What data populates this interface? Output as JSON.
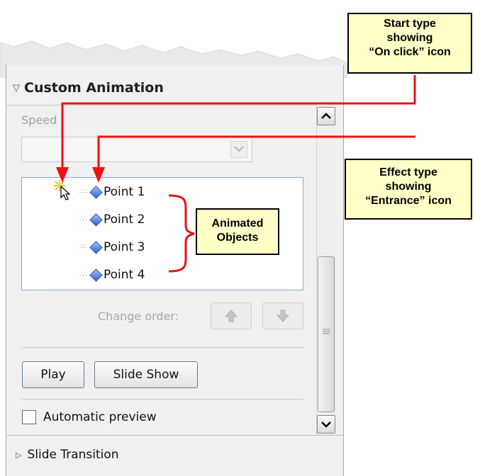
{
  "panel": {
    "header_title": "Custom Animation",
    "speed_label": "Speed",
    "speed_value": "",
    "list_items": [
      "Point 1",
      "Point 2",
      "Point 3",
      "Point 4"
    ],
    "change_order_label": "Change order:",
    "play_button": "Play",
    "slide_show_button": "Slide Show",
    "automatic_preview_label": "Automatic preview",
    "automatic_preview_checked": false,
    "slide_transition_label": "Slide Transition"
  },
  "callouts": {
    "start_type": [
      "Start type",
      "showing",
      "“On click” icon"
    ],
    "effect_type": [
      "Effect type",
      "showing",
      "“Entrance” icon"
    ],
    "animated_objects": [
      "Animated",
      "Objects"
    ]
  },
  "colors": {
    "arrow_red": "#ee1111",
    "callout_fill": "#ffffc8",
    "panel_bg": "#f0f0f0",
    "effect_diamond": "#2f5fd0"
  },
  "icons": {
    "start_type": "on-click-cursor-icon",
    "effect_type": "entrance-effect-icon"
  }
}
